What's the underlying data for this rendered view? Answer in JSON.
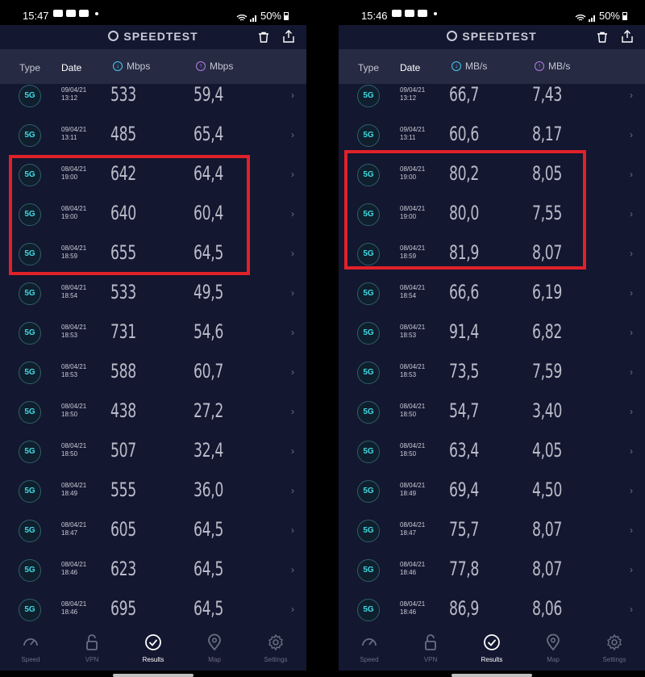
{
  "screens": [
    {
      "status": {
        "time": "15:47",
        "battery": "50%"
      },
      "app_title": "SPEEDTEST",
      "headers": {
        "type": "Type",
        "date": "Date",
        "download_unit": "Mbps",
        "upload_unit": "Mbps"
      },
      "rows": [
        {
          "net": "5G",
          "date": "09/04/21",
          "time": "13:12",
          "down": "533",
          "up": "59,4"
        },
        {
          "net": "5G",
          "date": "09/04/21",
          "time": "13:11",
          "down": "485",
          "up": "65,4"
        },
        {
          "net": "5G",
          "date": "08/04/21",
          "time": "19:00",
          "down": "642",
          "up": "64,4"
        },
        {
          "net": "5G",
          "date": "08/04/21",
          "time": "19:00",
          "down": "640",
          "up": "60,4"
        },
        {
          "net": "5G",
          "date": "08/04/21",
          "time": "18:59",
          "down": "655",
          "up": "64,5"
        },
        {
          "net": "5G",
          "date": "08/04/21",
          "time": "18:54",
          "down": "533",
          "up": "49,5"
        },
        {
          "net": "5G",
          "date": "08/04/21",
          "time": "18:53",
          "down": "731",
          "up": "54,6"
        },
        {
          "net": "5G",
          "date": "08/04/21",
          "time": "18:53",
          "down": "588",
          "up": "60,7"
        },
        {
          "net": "5G",
          "date": "08/04/21",
          "time": "18:50",
          "down": "438",
          "up": "27,2"
        },
        {
          "net": "5G",
          "date": "08/04/21",
          "time": "18:50",
          "down": "507",
          "up": "32,4"
        },
        {
          "net": "5G",
          "date": "08/04/21",
          "time": "18:49",
          "down": "555",
          "up": "36,0"
        },
        {
          "net": "5G",
          "date": "08/04/21",
          "time": "18:47",
          "down": "605",
          "up": "64,5"
        },
        {
          "net": "5G",
          "date": "08/04/21",
          "time": "18:46",
          "down": "623",
          "up": "64,5"
        },
        {
          "net": "5G",
          "date": "08/04/21",
          "time": "18:46",
          "down": "695",
          "up": "64,5"
        }
      ],
      "tabs": [
        "Speed",
        "VPN",
        "Results",
        "Map",
        "Settings"
      ],
      "active_tab": "Results"
    },
    {
      "status": {
        "time": "15:46",
        "battery": "50%"
      },
      "app_title": "SPEEDTEST",
      "headers": {
        "type": "Type",
        "date": "Date",
        "download_unit": "MB/s",
        "upload_unit": "MB/s"
      },
      "rows": [
        {
          "net": "5G",
          "date": "09/04/21",
          "time": "13:12",
          "down": "66,7",
          "up": "7,43"
        },
        {
          "net": "5G",
          "date": "09/04/21",
          "time": "13:11",
          "down": "60,6",
          "up": "8,17"
        },
        {
          "net": "5G",
          "date": "08/04/21",
          "time": "19:00",
          "down": "80,2",
          "up": "8,05"
        },
        {
          "net": "5G",
          "date": "08/04/21",
          "time": "19:00",
          "down": "80,0",
          "up": "7,55"
        },
        {
          "net": "5G",
          "date": "08/04/21",
          "time": "18:59",
          "down": "81,9",
          "up": "8,07"
        },
        {
          "net": "5G",
          "date": "08/04/21",
          "time": "18:54",
          "down": "66,6",
          "up": "6,19"
        },
        {
          "net": "5G",
          "date": "08/04/21",
          "time": "18:53",
          "down": "91,4",
          "up": "6,82"
        },
        {
          "net": "5G",
          "date": "08/04/21",
          "time": "18:53",
          "down": "73,5",
          "up": "7,59"
        },
        {
          "net": "5G",
          "date": "08/04/21",
          "time": "18:50",
          "down": "54,7",
          "up": "3,40"
        },
        {
          "net": "5G",
          "date": "08/04/21",
          "time": "18:50",
          "down": "63,4",
          "up": "4,05"
        },
        {
          "net": "5G",
          "date": "08/04/21",
          "time": "18:49",
          "down": "69,4",
          "up": "4,50"
        },
        {
          "net": "5G",
          "date": "08/04/21",
          "time": "18:47",
          "down": "75,7",
          "up": "8,07"
        },
        {
          "net": "5G",
          "date": "08/04/21",
          "time": "18:46",
          "down": "77,8",
          "up": "8,07"
        },
        {
          "net": "5G",
          "date": "08/04/21",
          "time": "18:46",
          "down": "86,9",
          "up": "8,06"
        }
      ],
      "tabs": [
        "Speed",
        "VPN",
        "Results",
        "Map",
        "Settings"
      ],
      "active_tab": "Results"
    }
  ],
  "colors": {
    "background": "#131730",
    "header_band": "#262b43",
    "badge_text": "#3fd9e0",
    "download_accent": "#45c8ef",
    "upload_accent": "#b77be6",
    "highlight": "#e02128"
  },
  "icons": {
    "download": "arrow-down-circle-icon",
    "upload": "arrow-up-circle-icon",
    "trash": "trash-icon",
    "share": "share-icon",
    "row_chevron": "chevron-right-icon"
  }
}
